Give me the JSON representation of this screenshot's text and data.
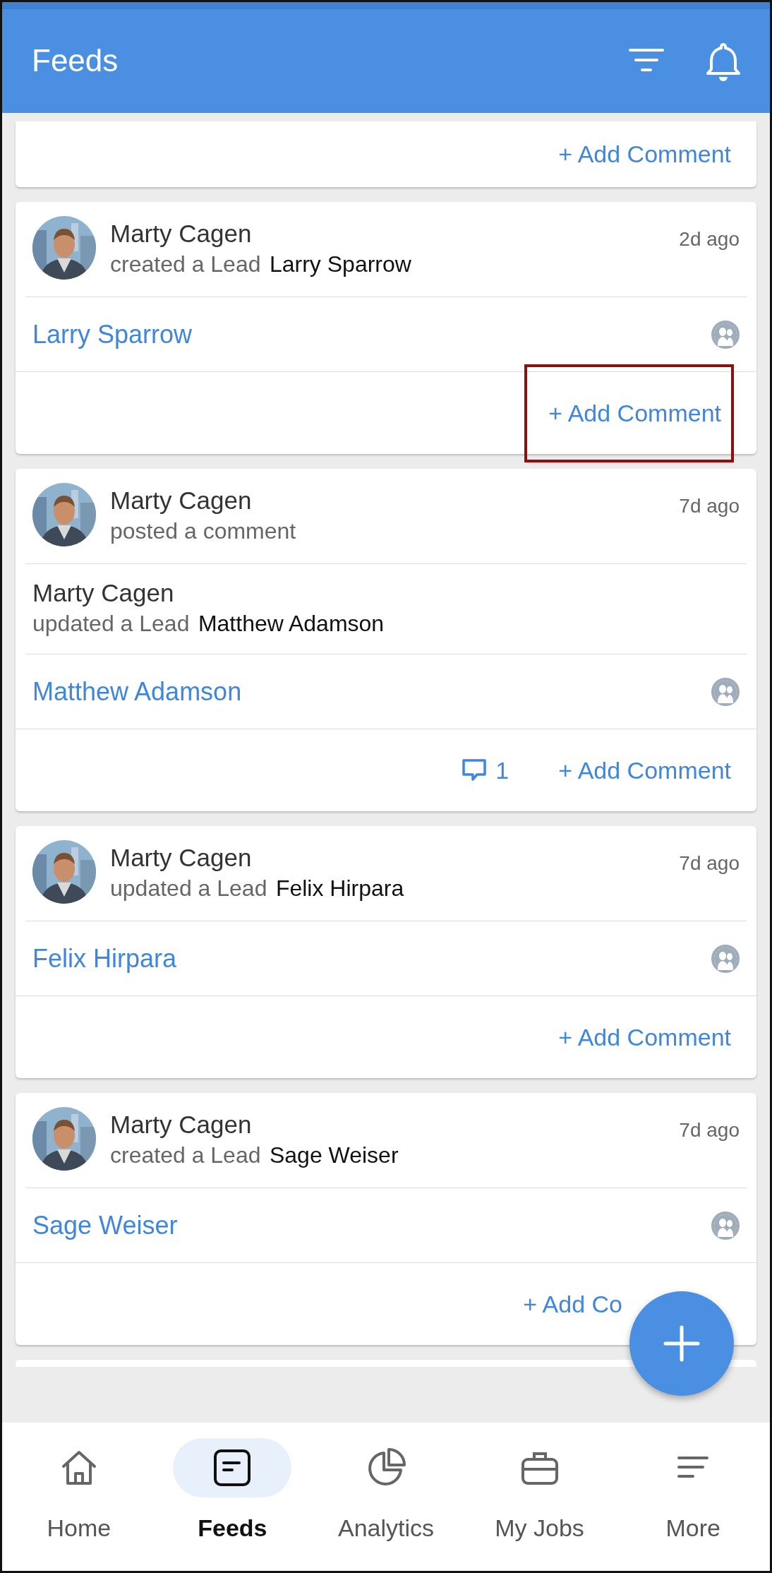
{
  "header": {
    "title": "Feeds"
  },
  "feed": [
    {
      "kind": "partial",
      "add_comment": "+ Add Comment",
      "highlighted": false
    },
    {
      "kind": "activity",
      "author": "Marty Cagen",
      "action": "created a Lead",
      "target": "Larry Sparrow",
      "time": "2d ago",
      "link": "Larry Sparrow",
      "add_comment": "+ Add Comment",
      "highlighted": true
    },
    {
      "kind": "activity",
      "author": "Marty Cagen",
      "action": "posted a comment",
      "time": "7d ago",
      "nested": {
        "author": "Marty Cagen",
        "action": "updated a Lead",
        "target": "Matthew Adamson"
      },
      "link": "Matthew Adamson",
      "comment_count": "1",
      "add_comment": "+ Add Comment",
      "highlighted": false
    },
    {
      "kind": "activity",
      "author": "Marty Cagen",
      "action": "updated a Lead",
      "target": "Felix Hirpara",
      "time": "7d ago",
      "link": "Felix Hirpara",
      "add_comment": "+ Add Comment",
      "highlighted": false
    },
    {
      "kind": "activity",
      "author": "Marty Cagen",
      "action": "created a Lead",
      "target": "Sage Weiser",
      "time": "7d ago",
      "link": "Sage Weiser",
      "add_comment": "+ Add Co",
      "highlighted": false
    }
  ],
  "nav": [
    {
      "label": "Home",
      "selected": false
    },
    {
      "label": "Feeds",
      "selected": true
    },
    {
      "label": "Analytics",
      "selected": false
    },
    {
      "label": "My Jobs",
      "selected": false
    },
    {
      "label": "More",
      "selected": false
    }
  ]
}
